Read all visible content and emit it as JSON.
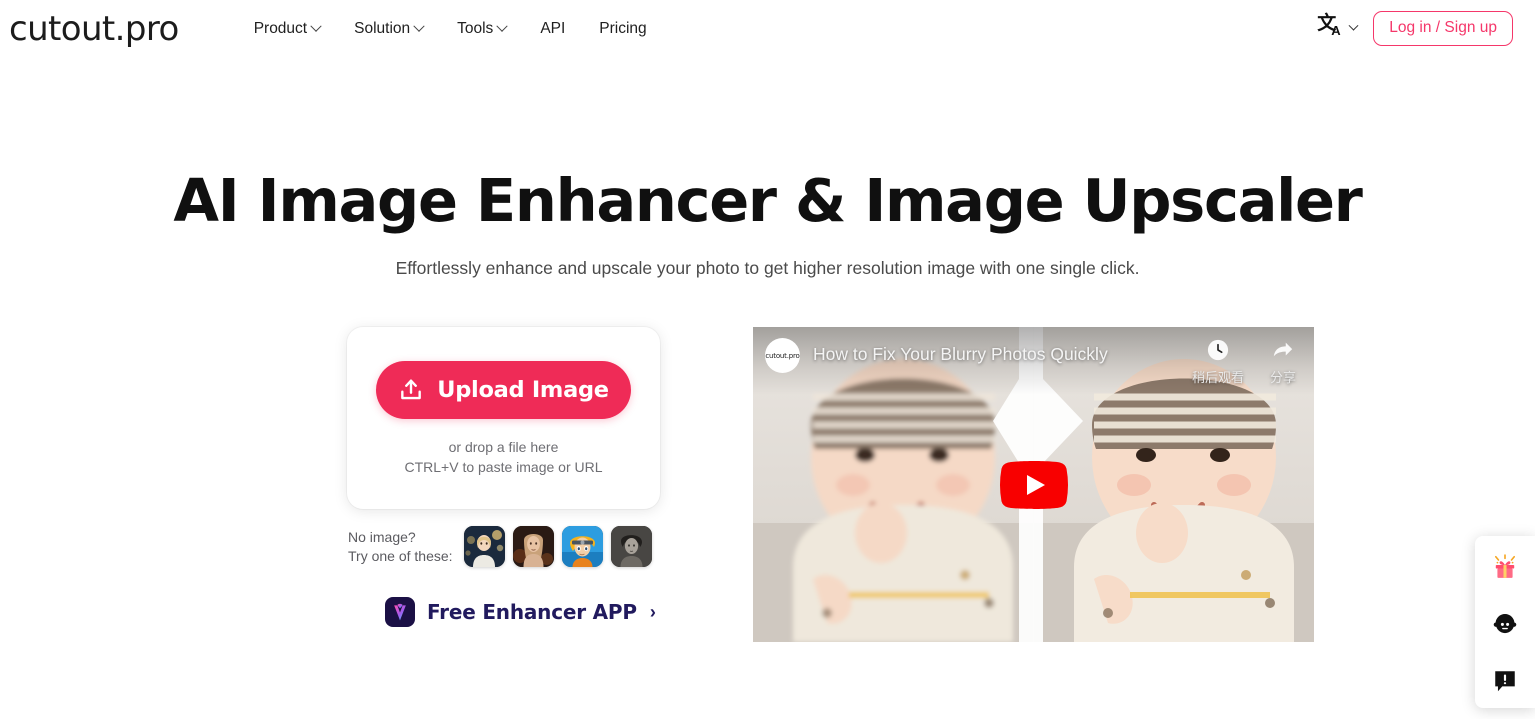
{
  "brand": {
    "logo": "cutout.pro",
    "accent_color": "#EF2B57",
    "login_border_color": "#F5376A",
    "app_text_color": "#211a5e"
  },
  "header": {
    "nav": [
      {
        "label": "Product",
        "has_dropdown": true
      },
      {
        "label": "Solution",
        "has_dropdown": true
      },
      {
        "label": "Tools",
        "has_dropdown": true
      },
      {
        "label": "API",
        "has_dropdown": false
      },
      {
        "label": "Pricing",
        "has_dropdown": false
      }
    ],
    "language": {
      "icon": "translate-icon",
      "glyph_cn": "文",
      "glyph_a": "A"
    },
    "login_label": "Log in / Sign up"
  },
  "hero": {
    "title": "AI Image Enhancer & Image Upscaler",
    "subtitle": "Effortlessly enhance and upscale your photo to get higher resolution image with one single click."
  },
  "upload": {
    "button_label": "Upload Image",
    "button_icon": "upload-icon",
    "drop_line_1": "or drop a file here",
    "drop_line_2": "CTRL+V to paste image or URL"
  },
  "samples": {
    "label_line_1": "No image?",
    "label_line_2": "Try one of these:",
    "thumbnails": [
      {
        "name": "sample-blonde-girl-bokeh"
      },
      {
        "name": "sample-woman-portrait"
      },
      {
        "name": "sample-anime-character"
      },
      {
        "name": "sample-vintage-bw-portrait"
      }
    ]
  },
  "app_promo": {
    "label": "Free Enhancer APP",
    "caret": "›",
    "icon": "enhancer-app-icon"
  },
  "video": {
    "title": "How to Fix Your Blurry Photos Quickly",
    "channel_avatar_text": "cutout.pro",
    "watch_later_label": "稍后观看",
    "share_label": "分享",
    "play_button": "youtube-play-icon"
  },
  "float_widget": {
    "items": [
      {
        "name": "gift-icon"
      },
      {
        "name": "support-agent-icon"
      },
      {
        "name": "feedback-icon"
      }
    ]
  }
}
